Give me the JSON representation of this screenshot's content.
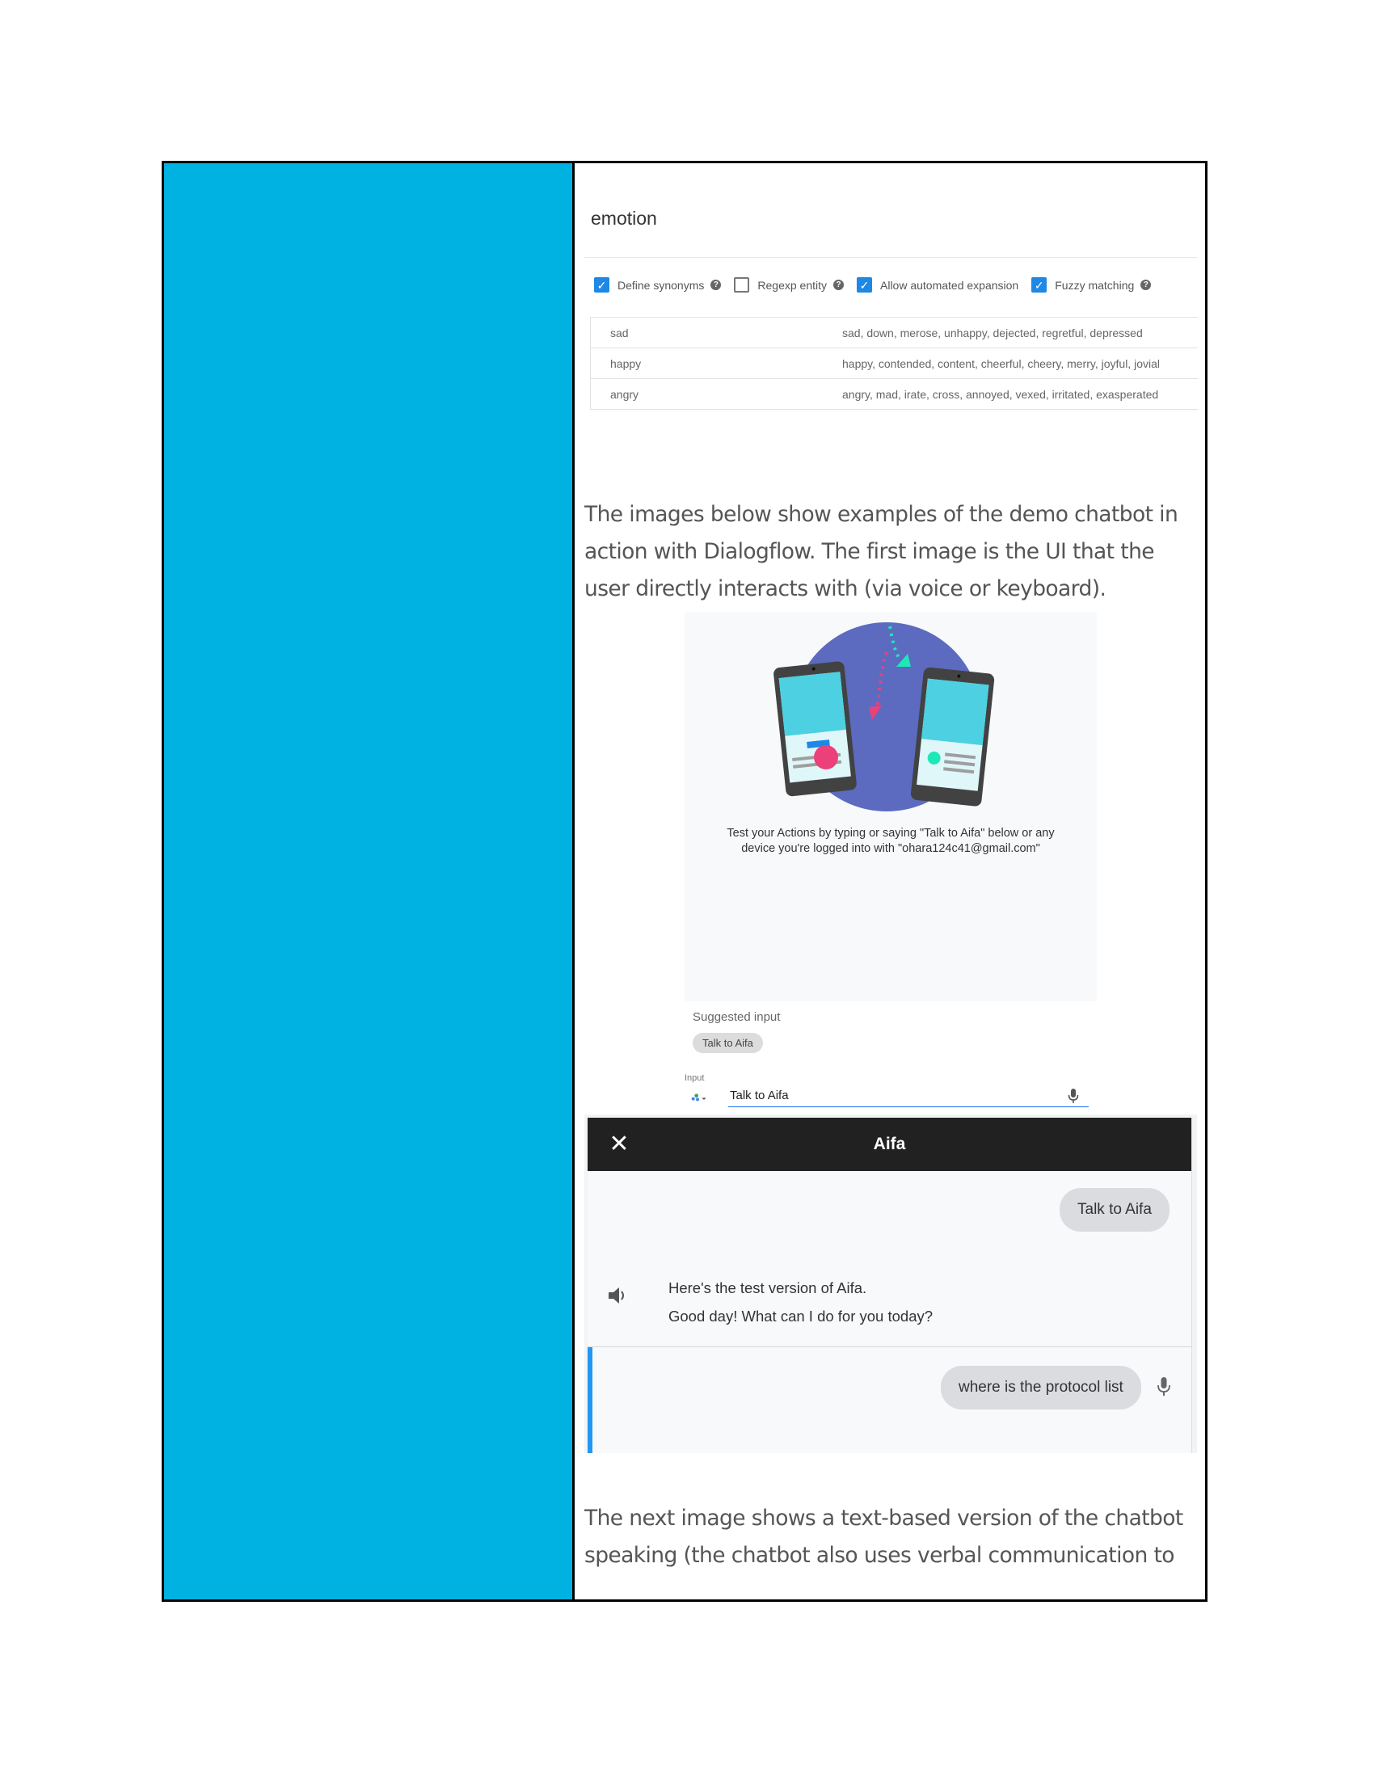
{
  "entity": {
    "name": "emotion",
    "options": [
      {
        "label": "Define synonyms",
        "checked": true,
        "help": true
      },
      {
        "label": "Regexp entity",
        "checked": false,
        "help": true
      },
      {
        "label": "Allow automated expansion",
        "checked": true,
        "help": false
      },
      {
        "label": "Fuzzy matching",
        "checked": true,
        "help": true
      }
    ],
    "rows": [
      {
        "value": "sad",
        "synonyms": "sad, down, merose, unhappy, dejected, regretful, depressed"
      },
      {
        "value": "happy",
        "synonyms": "happy, contended, content, cheerful, cheery, merry, joyful, jovial"
      },
      {
        "value": "angry",
        "synonyms": "angry, mad, irate, cross, annoyed, vexed, irritated, exasperated"
      }
    ]
  },
  "paragraph1": "The images below show examples of the demo chatbot in action with Dialogflow. The first image is the UI that the user directly interacts with (via voice or keyboard).",
  "simulator": {
    "caption_line1": "Test your Actions by typing or saying \"Talk to Aifa\" below or any",
    "caption_line2": "device you're logged into with \"ohara124c41@gmail.com\"",
    "suggested_label": "Suggested input",
    "suggested_chip": "Talk to Aifa",
    "input_label": "Input",
    "input_value": "Talk to Aifa"
  },
  "chat": {
    "title": "Aifa",
    "close_glyph": "✕",
    "user_message_1": "Talk to Aifa",
    "bot_line_1": "Here's the test version of Aifa.",
    "bot_line_2": "Good day! What can I do for you today?",
    "user_message_2": "where is the protocol list"
  },
  "paragraph2": "The next image shows a text-based version of the chatbot speaking (the chatbot also uses verbal communication to",
  "colors": {
    "sidebar_blue": "#00b2e2",
    "checkbox_blue": "#1e88e5",
    "chat_header": "#212121",
    "chat_accent": "#2196f3"
  },
  "icons": [
    "check-icon",
    "help-icon",
    "assistant-icon",
    "chevron-down-icon",
    "mic-icon",
    "close-icon",
    "speaker-icon"
  ]
}
